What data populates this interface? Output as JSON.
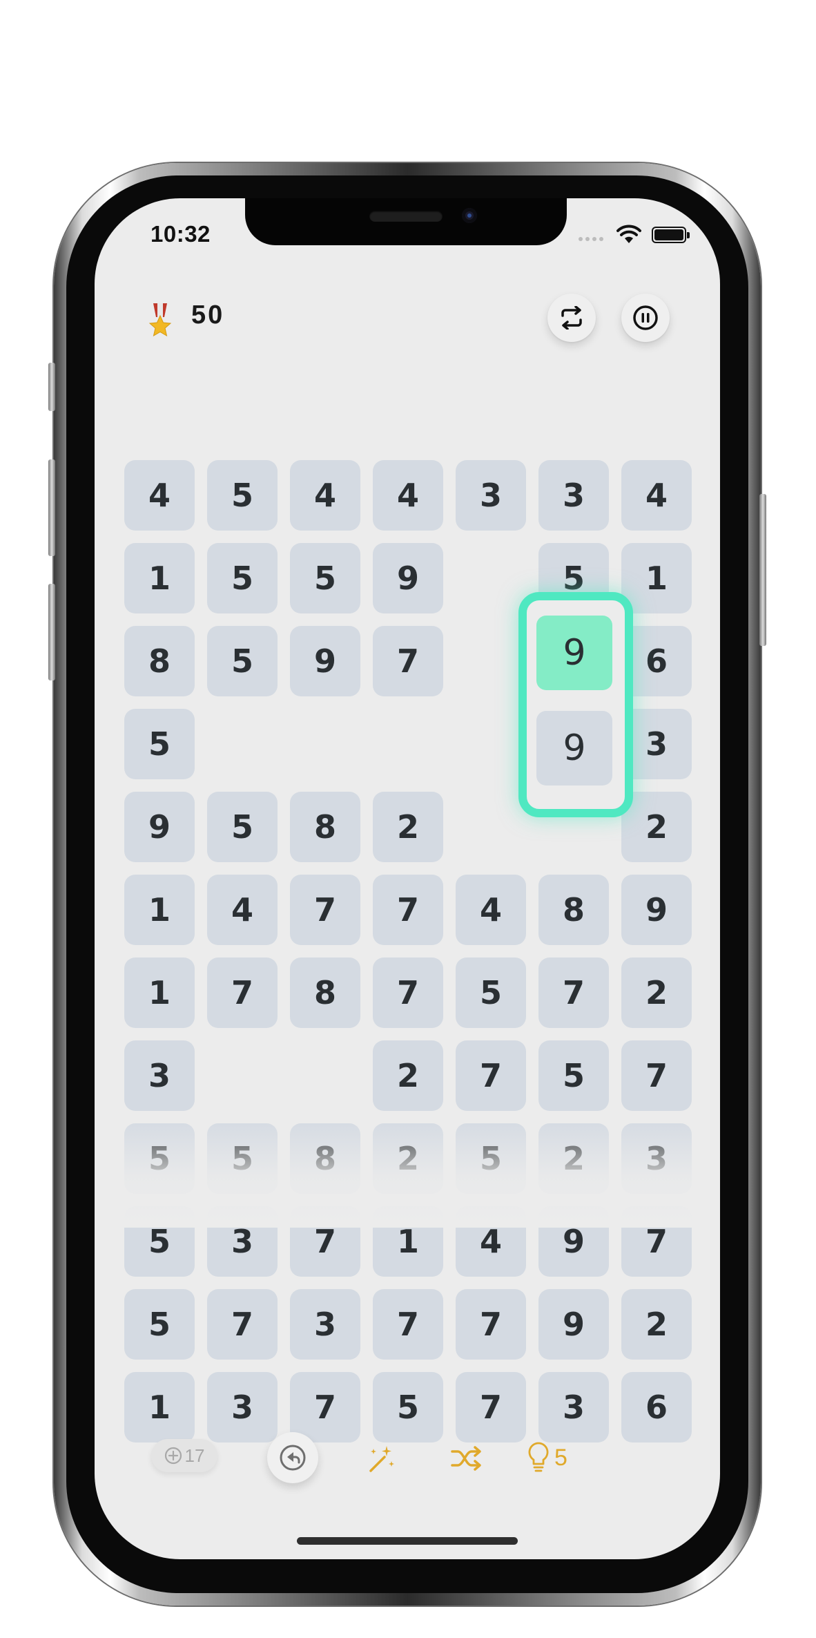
{
  "status_bar": {
    "time": "10:32"
  },
  "header": {
    "score": "50"
  },
  "board": {
    "rows": [
      [
        "4",
        "5",
        "4",
        "4",
        "3",
        "3",
        "4"
      ],
      [
        "1",
        "5",
        "5",
        "9",
        "",
        "5",
        "1"
      ],
      [
        "8",
        "5",
        "9",
        "7",
        "",
        "",
        "6"
      ],
      [
        "5",
        "",
        "",
        "",
        "",
        "",
        "3"
      ],
      [
        "9",
        "5",
        "8",
        "2",
        "",
        "",
        "2"
      ],
      [
        "1",
        "4",
        "7",
        "7",
        "4",
        "8",
        "9"
      ],
      [
        "1",
        "7",
        "8",
        "7",
        "5",
        "7",
        "2"
      ],
      [
        "3",
        "",
        "",
        "2",
        "7",
        "5",
        "7"
      ],
      [
        "5",
        "5",
        "8",
        "2",
        "5",
        "2",
        "3"
      ],
      [
        "5",
        "3",
        "7",
        "1",
        "4",
        "9",
        "7"
      ],
      [
        "5",
        "7",
        "3",
        "7",
        "7",
        "9",
        "2"
      ],
      [
        "1",
        "3",
        "7",
        "5",
        "7",
        "3",
        "6"
      ]
    ],
    "highlight": {
      "selected_value": "9",
      "second_value": "9",
      "color": "#4fe8c1",
      "selected_fill": "#84ecc6"
    },
    "tile_color": "#d4dae2"
  },
  "toolbar": {
    "add_rows_count": "17",
    "hint_count": "5",
    "accent_color": "#e0a92b",
    "icons": [
      "plus-circle-icon",
      "undo-icon",
      "magic-wand-icon",
      "shuffle-icon",
      "lightbulb-icon"
    ]
  }
}
